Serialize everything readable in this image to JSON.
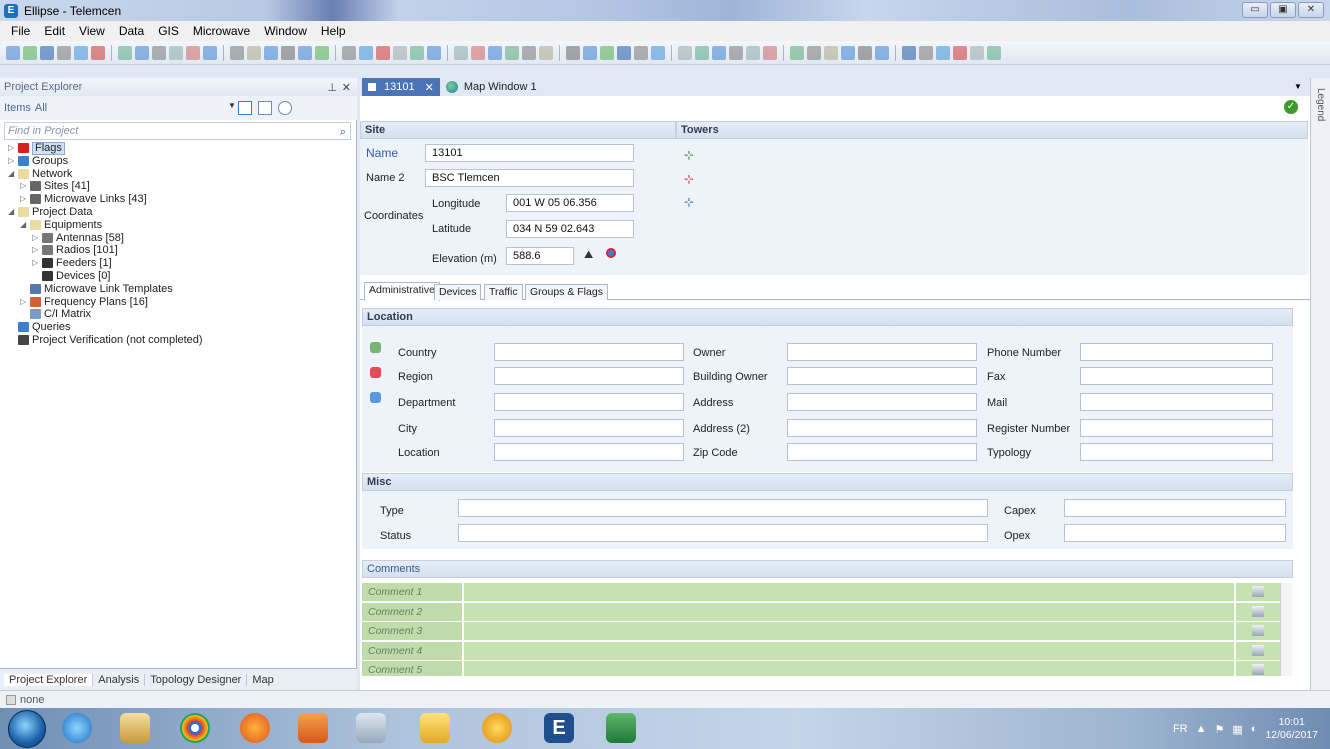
{
  "window": {
    "title": "Ellipse - Telemcen",
    "icon_letter": "E",
    "min": "▭",
    "max": "▣",
    "close": "✕"
  },
  "menu": [
    "File",
    "Edit",
    "View",
    "Data",
    "GIS",
    "Microwave",
    "Window",
    "Help"
  ],
  "explorer": {
    "title": "Project Explorer",
    "pin": "⊥",
    "close": "✕",
    "items_label": "Items",
    "items_value": "All",
    "find_placeholder": "Find in Project",
    "tree": [
      {
        "label": "Flags",
        "depth": 0,
        "tw": "▷",
        "icon": "flag-icon",
        "color": "#d62020",
        "selected": true
      },
      {
        "label": "Groups",
        "depth": 0,
        "tw": "▷",
        "icon": "groups-icon",
        "color": "#3d7fd0"
      },
      {
        "label": "Network",
        "depth": 0,
        "tw": "◢",
        "icon": "folder-icon",
        "color": "#e9dca0"
      },
      {
        "label": "Sites [41]",
        "depth": 1,
        "tw": "▷",
        "icon": "site-icon",
        "color": "#666"
      },
      {
        "label": "Microwave Links [43]",
        "depth": 1,
        "tw": "▷",
        "icon": "mw-link-icon",
        "color": "#666"
      },
      {
        "label": "Project Data",
        "depth": 0,
        "tw": "◢",
        "icon": "folder-icon",
        "color": "#e9dca0"
      },
      {
        "label": "Equipments",
        "depth": 1,
        "tw": "◢",
        "icon": "folder-icon",
        "color": "#e9dca0"
      },
      {
        "label": "Antennas [58]",
        "depth": 2,
        "tw": "▷",
        "icon": "antenna-icon",
        "color": "#777"
      },
      {
        "label": "Radios [101]",
        "depth": 2,
        "tw": "▷",
        "icon": "radio-icon",
        "color": "#777"
      },
      {
        "label": "Feeders [1]",
        "depth": 2,
        "tw": "▷",
        "icon": "feeder-icon",
        "color": "#333"
      },
      {
        "label": "Devices [0]",
        "depth": 2,
        "tw": "",
        "icon": "device-icon",
        "color": "#333"
      },
      {
        "label": "Microwave Link Templates",
        "depth": 1,
        "tw": "",
        "icon": "template-icon",
        "color": "#5577aa"
      },
      {
        "label": "Frequency Plans [16]",
        "depth": 1,
        "tw": "▷",
        "icon": "frequency-plan-icon",
        "color": "#d2613a"
      },
      {
        "label": "C/I Matrix",
        "depth": 1,
        "tw": "",
        "icon": "matrix-icon",
        "color": "#7a9cc8"
      },
      {
        "label": "Queries",
        "depth": 0,
        "tw": "",
        "icon": "queries-icon",
        "color": "#3d7fd0"
      },
      {
        "label": "Project Verification (not completed)",
        "depth": 0,
        "tw": "",
        "icon": "wrench-icon",
        "color": "#444"
      }
    ],
    "bottom_tabs": [
      "Project Explorer",
      "Analysis",
      "Topology Designer",
      "Map"
    ]
  },
  "doc_tabs": {
    "active": "13101",
    "active_close": "✕",
    "other": "Map Window 1",
    "legend": "Legend"
  },
  "site": {
    "header": "Site",
    "name_label": "Name",
    "name_value": "13101",
    "name2_label": "Name 2",
    "name2_value": "BSC Tlemcen",
    "coords_label": "Coordinates",
    "lon_label": "Longitude",
    "lon_value": "001 W 05 06.356",
    "lat_label": "Latitude",
    "lat_value": "034 N 59 02.643",
    "elev_label": "Elevation (m)",
    "elev_value": "588.6"
  },
  "towers": {
    "header": "Towers"
  },
  "tabs": [
    "Administrative",
    "Devices",
    "Traffic",
    "Groups & Flags"
  ],
  "location": {
    "header": "Location",
    "col1": [
      "Country",
      "Region",
      "Department",
      "City",
      "Location"
    ],
    "col2": [
      "Owner",
      "Building Owner",
      "Address",
      "Address (2)",
      "Zip Code"
    ],
    "col3": [
      "Phone Number",
      "Fax",
      "Mail",
      "Register Number",
      "Typology"
    ]
  },
  "misc": {
    "header": "Misc",
    "left": [
      "Type",
      "Status"
    ],
    "right": [
      "Capex",
      "Opex"
    ]
  },
  "comments": {
    "header": "Comments",
    "rows": [
      "Comment 1",
      "Comment 2",
      "Comment 3",
      "Comment 4",
      "Comment 5"
    ]
  },
  "status": {
    "text": "none"
  },
  "tray": {
    "lang": "FR",
    "time": "10:01",
    "date": "12/06/2017"
  },
  "colors": {
    "accent": "#4a74b5",
    "comment_green": "#c5e2b0",
    "section_bg": "#eef3f9"
  }
}
